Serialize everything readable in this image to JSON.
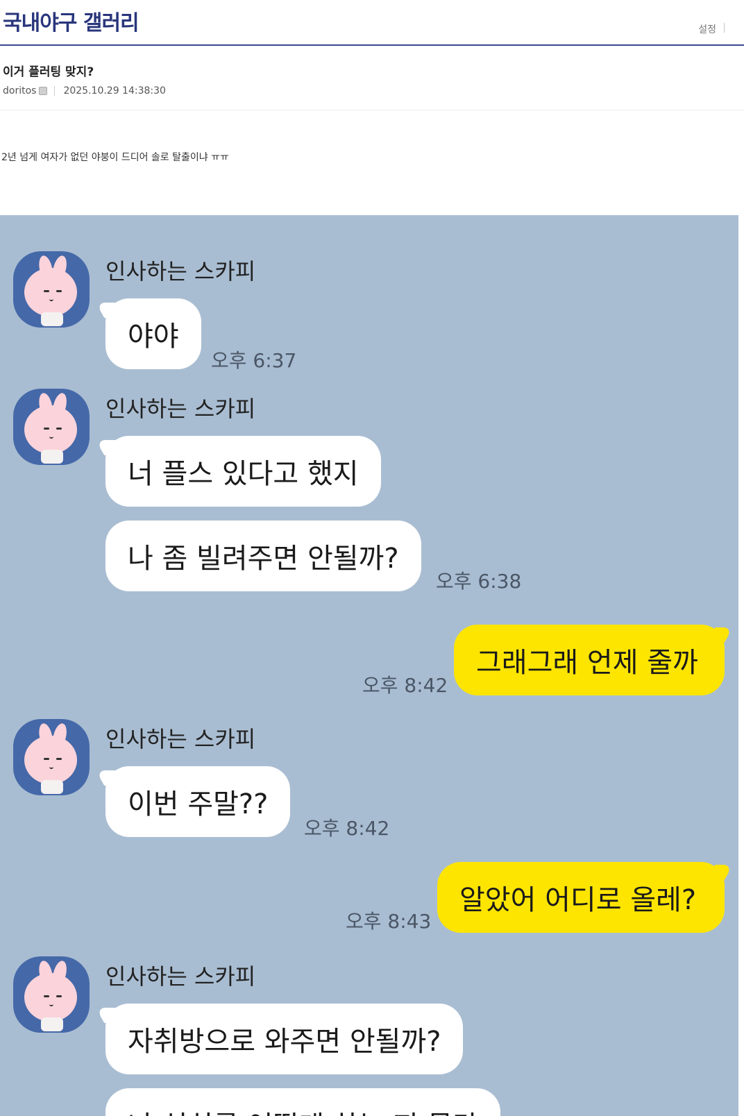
{
  "header": {
    "title": "국내야구 갤러리",
    "settings_label": "설정",
    "separator": "|"
  },
  "post": {
    "title": "이거 플러팅 맞지?",
    "author": "doritos",
    "datetime": "2025.10.29 14:38:30",
    "body": "2년 넘게 여자가 없던 야붕이 드디어 솔로 탈출이냐 ㅠㅠ"
  },
  "chat": {
    "background_color": "#a9bdd2",
    "my_bubble_color": "#fee500",
    "messages": [
      {
        "sender": "인사하는 스카피",
        "text": "야야",
        "time": "오후 6:37"
      },
      {
        "sender": "인사하는 스카피",
        "text": "너 플스 있다고 했지"
      },
      {
        "text": "나 좀 빌려주면 안될까?",
        "time": "오후 6:38"
      },
      {
        "text": "그래그래 언제 줄까",
        "time": "오후 8:42"
      },
      {
        "sender": "인사하는 스카피",
        "text": "이번 주말??",
        "time": "오후 8:42"
      },
      {
        "text": "알았어 어디로 올레?",
        "time": "오후 8:43"
      },
      {
        "sender": "인사하는 스카피",
        "text": "자취방으로 와주면 안될까?"
      },
      {
        "text": "나 설치를 어떻게 하는 지 몰라"
      }
    ]
  }
}
